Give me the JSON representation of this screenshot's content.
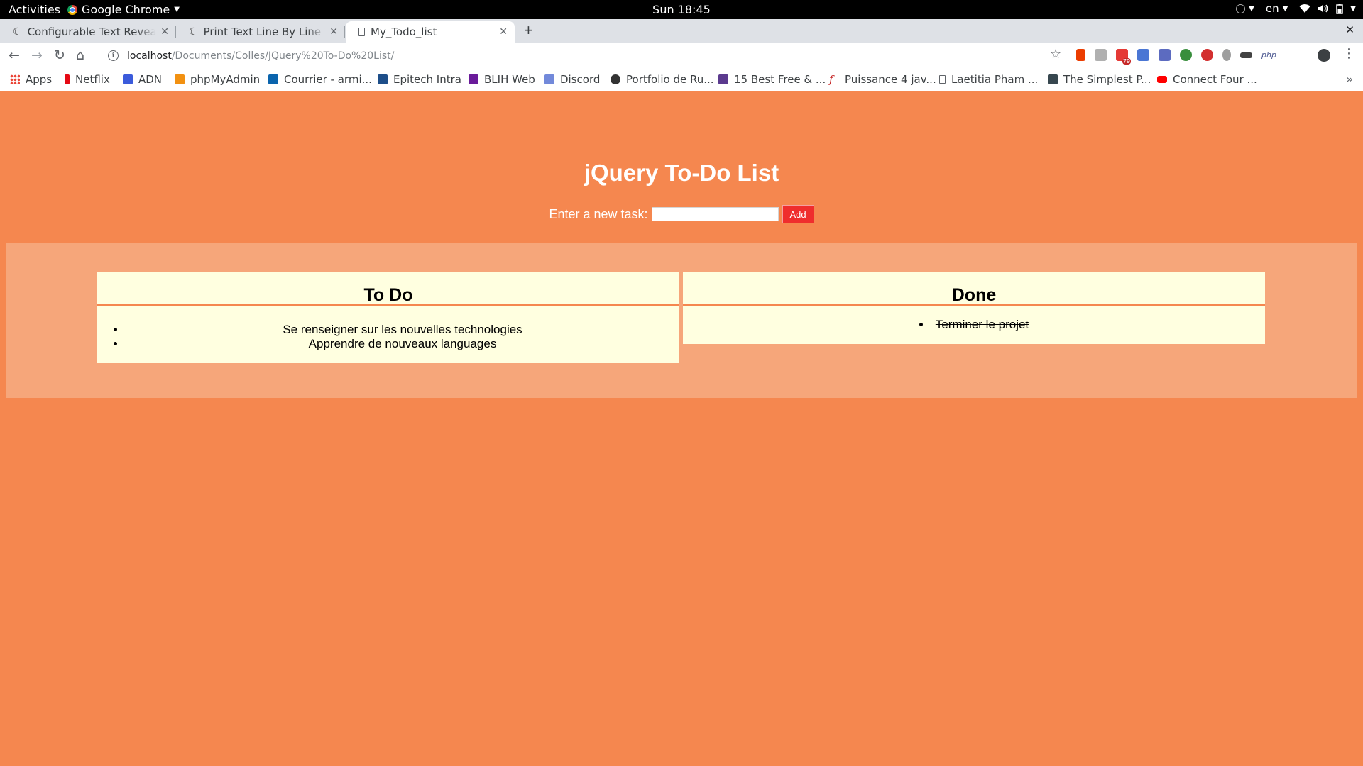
{
  "system_bar": {
    "activities": "Activities",
    "app_name": "Google Chrome",
    "clock": "Sun 18:45",
    "language": "en"
  },
  "browser": {
    "tabs": [
      {
        "title": "Configurable Text Reveal",
        "active": false
      },
      {
        "title": "Print Text Line By Line Wit",
        "active": false
      },
      {
        "title": "My_Todo_list",
        "active": true
      }
    ],
    "url_host": "localhost",
    "url_path": "/Documents/Colles/JQuery%20To-Do%20List/",
    "extension_badge": "79",
    "ext_php_label": "php",
    "bookmarks": [
      {
        "label": "Apps",
        "icon": "apps-grid-icon",
        "color": "#ea4335"
      },
      {
        "label": "Netflix",
        "icon": "netflix-icon",
        "color": "#e50914"
      },
      {
        "label": "ADN",
        "icon": "adn-icon",
        "color": "#3b5bdb"
      },
      {
        "label": "phpMyAdmin",
        "icon": "phpmyadmin-icon",
        "color": "#f29111"
      },
      {
        "label": "Courrier - armi...",
        "icon": "outlook-icon",
        "color": "#0a64ad"
      },
      {
        "label": "Epitech Intra",
        "icon": "epitech-icon",
        "color": "#1d4e89"
      },
      {
        "label": "BLIH Web",
        "icon": "blih-icon",
        "color": "#6a1b9a"
      },
      {
        "label": "Discord",
        "icon": "discord-icon",
        "color": "#7289da"
      },
      {
        "label": "Portfolio de Ru...",
        "icon": "github-icon",
        "color": "#333333"
      },
      {
        "label": "15 Best Free & ...",
        "icon": "site-icon",
        "color": "#5b3a8e"
      },
      {
        "label": "Puissance 4 jav...",
        "icon": "flash-icon",
        "color": "#c62828"
      },
      {
        "label": "Laetitia Pham ...",
        "icon": "page-icon",
        "color": "#9aa0a6"
      },
      {
        "label": "The Simplest P...",
        "icon": "floppy-icon",
        "color": "#37474f"
      },
      {
        "label": "Connect Four ...",
        "icon": "youtube-icon",
        "color": "#ff0000"
      }
    ]
  },
  "page": {
    "title": "jQuery To-Do List",
    "task_label": "Enter a new task:",
    "task_value": "",
    "add_button": "Add",
    "todo": {
      "heading": "To Do",
      "items": [
        "Se renseigner sur les nouvelles technologies",
        "Apprendre de nouveaux languages"
      ]
    },
    "done": {
      "heading": "Done",
      "items": [
        "Terminer le projet"
      ]
    }
  },
  "colors": {
    "page_bg": "#f5874f",
    "band_bg": "#f6a67a",
    "panel_bg": "#ffffe0",
    "add_button": "#ef2d2d"
  }
}
